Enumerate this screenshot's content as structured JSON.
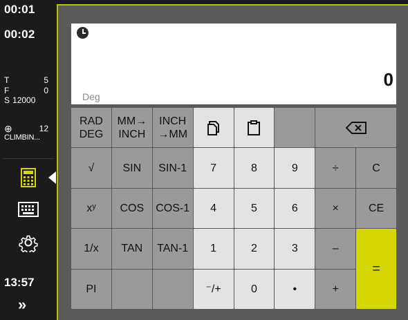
{
  "sidebar": {
    "timer_1": "00:01",
    "timer_2": "00:02",
    "tool": {
      "label": "T",
      "value": "5"
    },
    "feed": {
      "label": "F",
      "value": "0"
    },
    "spindle": {
      "label": "S",
      "value": "12000"
    },
    "probe": {
      "symbol": "⊕",
      "value": "12"
    },
    "climb_label": "CLIMBIN...",
    "clock": "13:57",
    "expand": "»"
  },
  "display": {
    "value": "0",
    "angle_mode": "Deg"
  },
  "keys": {
    "rad_deg": [
      "RAD",
      "DEG"
    ],
    "mm_inch": [
      "MM→",
      "INCH"
    ],
    "inch_mm": [
      "INCH",
      "→MM"
    ],
    "sqrt": "√",
    "sin": "SIN",
    "asin": "SIN-1",
    "seven": "7",
    "eight": "8",
    "nine": "9",
    "divide": "÷",
    "clear": "C",
    "power": "xʸ",
    "cos": "COS",
    "acos": "COS-1",
    "four": "4",
    "five": "5",
    "six": "6",
    "multiply": "×",
    "clear_entry": "CE",
    "reciprocal": "1/x",
    "tan": "TAN",
    "atan": "TAN-1",
    "one": "1",
    "two": "2",
    "three": "3",
    "minus": "–",
    "equals": "=",
    "pi": "PI",
    "negate": "⁻/+",
    "zero": "0",
    "decimal": "•",
    "plus": "+"
  },
  "colors": {
    "accent": "#b8c200",
    "equals": "#d6d600",
    "panel": "#5a5a5a"
  }
}
